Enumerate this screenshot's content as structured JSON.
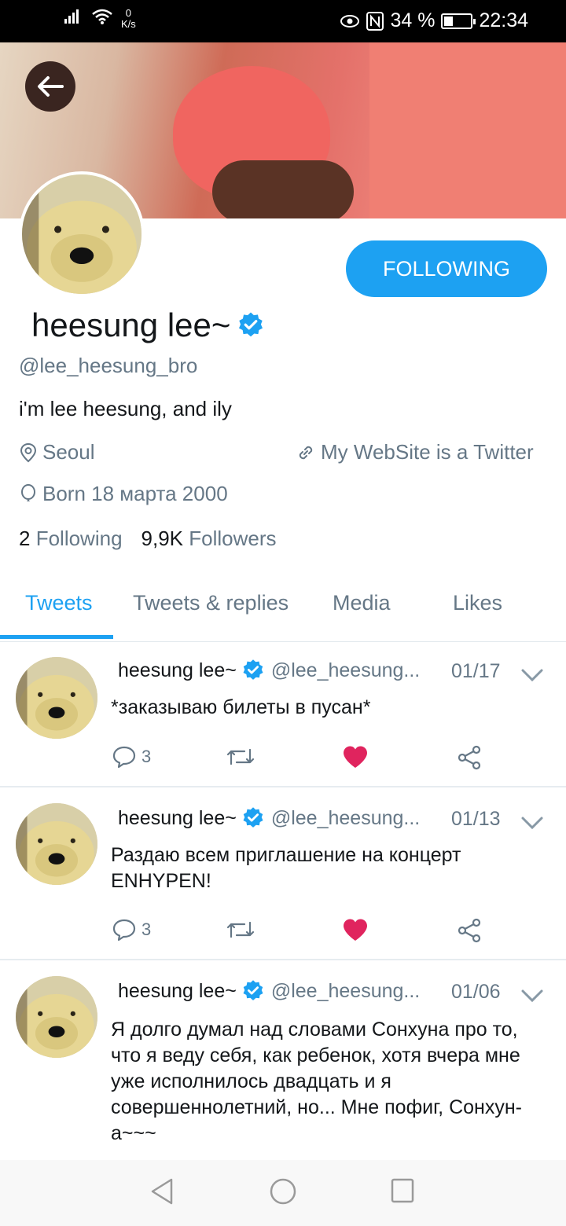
{
  "status": {
    "net_speed_value": "0",
    "net_speed_unit": "K/s",
    "battery": "34 %",
    "battery_level": 0.34,
    "time": "22:34"
  },
  "profile": {
    "name": "heesung lee~",
    "handle": "@lee_heesung_bro",
    "bio": "i'm lee heesung, and ily",
    "location": "Seoul",
    "website": "My WebSite is a Twitter",
    "born": "Born 18 марта 2000",
    "following_count": "2",
    "following_label": "Following",
    "followers_count": "9,9K",
    "followers_label": "Followers",
    "follow_button": "FOLLOWING"
  },
  "tabs": [
    {
      "label": "Tweets",
      "active": true
    },
    {
      "label": "Tweets & replies",
      "active": false
    },
    {
      "label": "Media",
      "active": false
    },
    {
      "label": "Likes",
      "active": false
    }
  ],
  "tweets": [
    {
      "name": "heesung lee~",
      "handle": "@lee_heesung...",
      "date": "01/17",
      "text": "*заказываю билеты в пусан*",
      "replies": "3"
    },
    {
      "name": "heesung lee~",
      "handle": "@lee_heesung...",
      "date": "01/13",
      "text": "Раздаю всем приглашение на концерт ENHYPEN!",
      "replies": "3"
    },
    {
      "name": "heesung lee~",
      "handle": "@lee_heesung...",
      "date": "01/06",
      "text": "Я долго думал над словами Сонхуна про то, что я веду себя, как ребенок, хотя вчера мне уже исполнилось двадцать и я совершеннолетний, но... Мне пофиг, Сонхун-а~~~"
    }
  ],
  "colors": {
    "accent": "#1da1f2",
    "like": "#e0245e",
    "secondary_text": "#657786"
  },
  "icons": [
    "back-arrow-icon",
    "verified-badge-icon",
    "location-pin-icon",
    "link-icon",
    "birthday-balloon-icon",
    "reply-icon",
    "retweet-icon",
    "like-heart-icon",
    "share-icon",
    "chevron-down-icon"
  ]
}
